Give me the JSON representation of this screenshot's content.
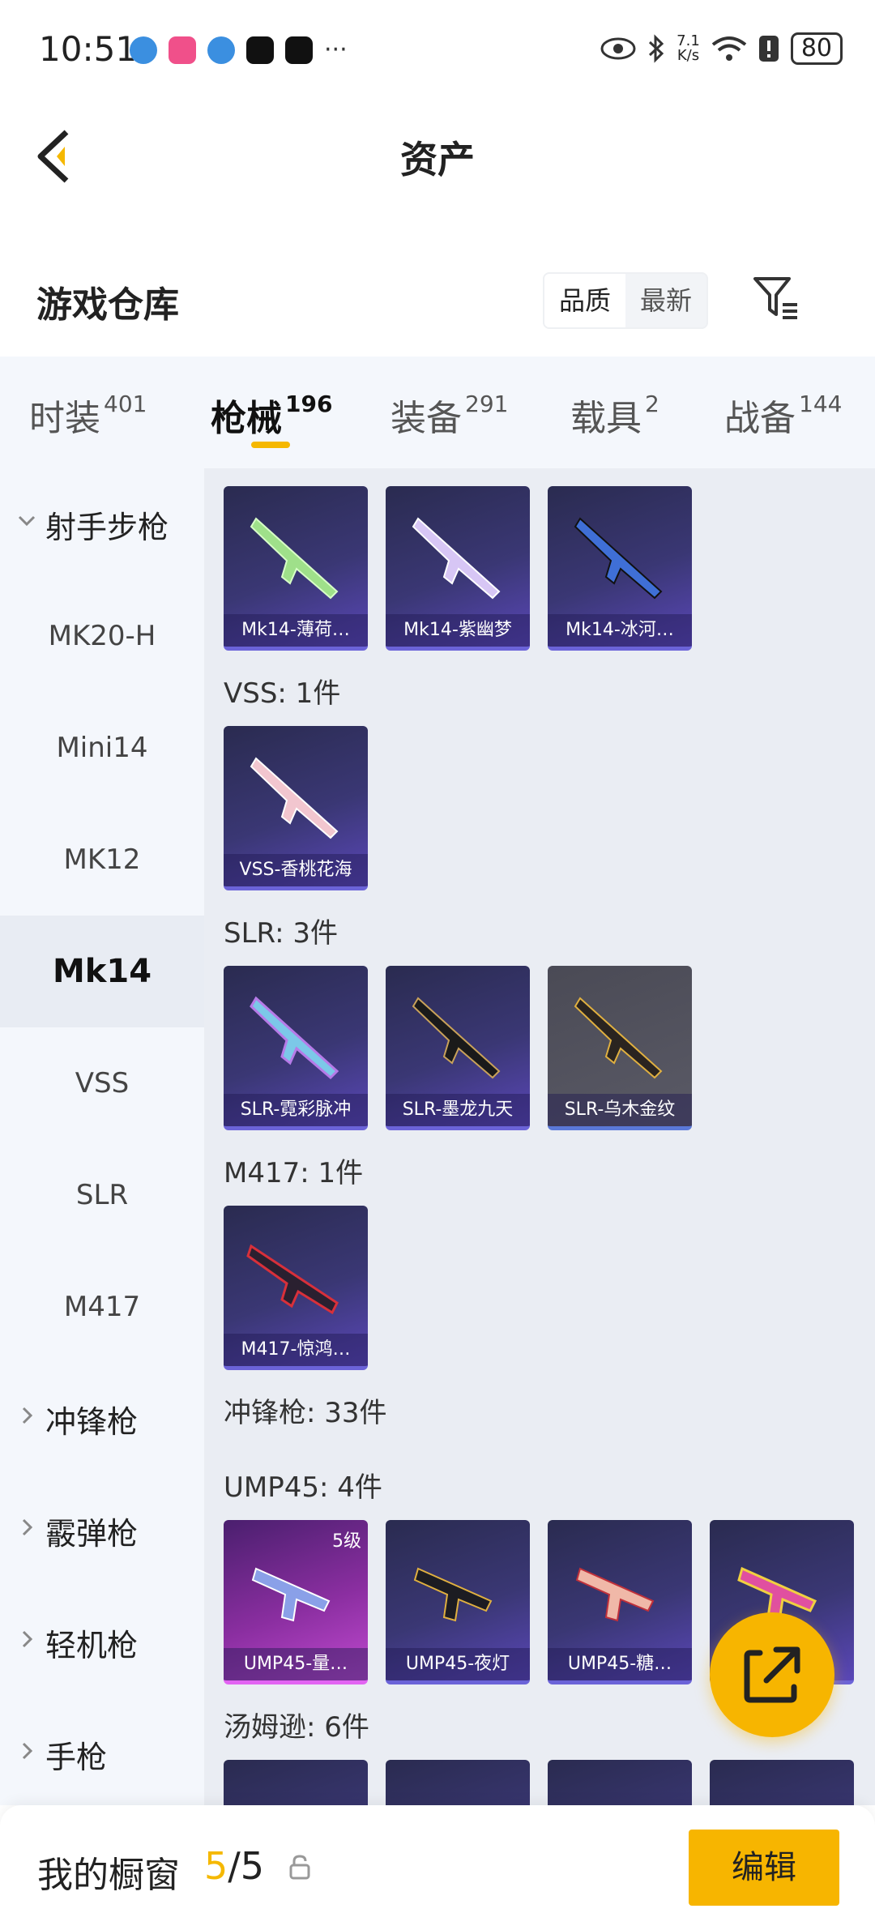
{
  "status_bar": {
    "time": "10:51",
    "net_speed": "7.1\nK/s",
    "battery": "80",
    "more": "···"
  },
  "header": {
    "title": "资产",
    "back_icon": "chevron-left-icon"
  },
  "warehouse": {
    "title": "游戏仓库",
    "sort_options": [
      "品质",
      "最新"
    ],
    "active_sort": "品质",
    "filter_icon": "filter-icon"
  },
  "tabs": [
    {
      "label": "时装",
      "count": "401"
    },
    {
      "label": "枪械",
      "count": "196"
    },
    {
      "label": "装备",
      "count": "291"
    },
    {
      "label": "载具",
      "count": "2"
    },
    {
      "label": "战备",
      "count": "144"
    }
  ],
  "sidebar": [
    {
      "label": "射手步枪",
      "type": "group",
      "expanded": true
    },
    {
      "label": "MK20-H"
    },
    {
      "label": "Mini14"
    },
    {
      "label": "MK12"
    },
    {
      "label": "Mk14",
      "active": true
    },
    {
      "label": "VSS"
    },
    {
      "label": "SLR"
    },
    {
      "label": "M417"
    },
    {
      "label": "冲锋枪",
      "type": "group"
    },
    {
      "label": "霰弹枪",
      "type": "group"
    },
    {
      "label": "轻机枪",
      "type": "group"
    },
    {
      "label": "手枪",
      "type": "group"
    }
  ],
  "content": {
    "mk14_items": [
      "Mk14-薄荷…",
      "Mk14-紫幽梦",
      "Mk14-冰河…"
    ],
    "vss_label": "VSS: 1件",
    "vss_items": [
      "VSS-香桃花海"
    ],
    "slr_label": "SLR: 3件",
    "slr_items": [
      "SLR-霓彩脉冲",
      "SLR-墨龙九天",
      "SLR-乌木金纹"
    ],
    "m417_label": "M417: 1件",
    "m417_items": [
      "M417-惊鸿…"
    ],
    "smg_label": "冲锋枪: 33件",
    "ump_label": "UMP45: 4件",
    "ump_items": [
      "UMP45-量…",
      "UMP45-夜灯",
      "UMP45-糖…"
    ],
    "ump_level": "5级",
    "thompson_label": "汤姆逊: 6件"
  },
  "bottom_bar": {
    "label": "我的橱窗",
    "current": "5",
    "total": "/5",
    "edit_label": "编辑"
  },
  "colors": {
    "accent": "#f7b500",
    "card_purple": "#3a3774",
    "card_pink": "#8a2ea0"
  }
}
